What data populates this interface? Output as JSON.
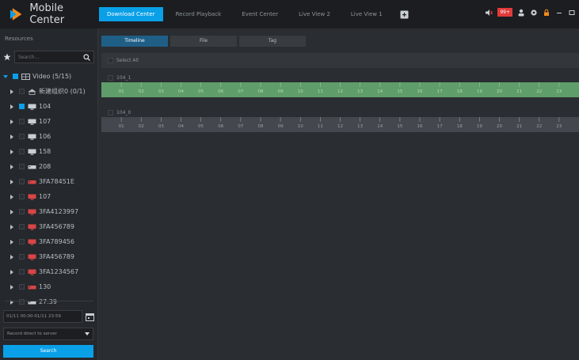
{
  "app": {
    "title": "Mobile Center",
    "nav_tabs": [
      {
        "label": "Download Center",
        "active": true
      },
      {
        "label": "Record Playback",
        "active": false
      },
      {
        "label": "Event Center",
        "active": false
      },
      {
        "label": "Live View 2",
        "active": false
      },
      {
        "label": "Live View 1",
        "active": false
      }
    ],
    "tray": {
      "alarm_count": "99+",
      "icons": [
        "speaker-icon",
        "alarm-badge",
        "user-icon",
        "gear-icon",
        "lock-icon",
        "minimize-icon",
        "maximize-icon"
      ]
    },
    "accent_color": "#0aa0e8"
  },
  "sidebar": {
    "title": "Resources",
    "search_placeholder": "Search...",
    "tree": [
      {
        "label": "Video (5/15)",
        "level": 0,
        "expanded": true,
        "check": "partial",
        "icon": "video-group-icon"
      },
      {
        "label": "新建组织0 (0/1)",
        "level": 1,
        "check": "none",
        "icon": "org-icon"
      },
      {
        "label": "104",
        "level": 1,
        "check": "checked",
        "icon": "monitor-icon"
      },
      {
        "label": "107",
        "level": 1,
        "check": "none",
        "icon": "monitor-icon"
      },
      {
        "label": "106",
        "level": 1,
        "check": "none",
        "icon": "monitor-icon"
      },
      {
        "label": "158",
        "level": 1,
        "check": "none",
        "icon": "monitor-icon"
      },
      {
        "label": "208",
        "level": 1,
        "check": "none",
        "icon": "recorder-icon"
      },
      {
        "label": "3FA78451E",
        "level": 1,
        "check": "none",
        "icon": "recorder-red-icon"
      },
      {
        "label": "107",
        "level": 1,
        "check": "none",
        "icon": "monitor-red-icon"
      },
      {
        "label": "3FA4123997",
        "level": 1,
        "check": "none",
        "icon": "monitor-red-icon"
      },
      {
        "label": "3FA456789",
        "level": 1,
        "check": "none",
        "icon": "monitor-red-icon"
      },
      {
        "label": "3FA789456",
        "level": 1,
        "check": "none",
        "icon": "monitor-red-icon"
      },
      {
        "label": "3FA456789",
        "level": 1,
        "check": "none",
        "icon": "monitor-red-icon"
      },
      {
        "label": "3FA1234567",
        "level": 1,
        "check": "none",
        "icon": "monitor-red-icon"
      },
      {
        "label": "130",
        "level": 1,
        "check": "none",
        "icon": "recorder-red-icon"
      },
      {
        "label": "27.39",
        "level": 1,
        "check": "none",
        "icon": "recorder-icon"
      }
    ],
    "date_range": "01/11 00:00-01/11 23:59",
    "record_source": "Record direct to server",
    "search_button": "Search"
  },
  "main": {
    "subtabs": [
      {
        "label": "Timeline",
        "active": true
      },
      {
        "label": "File",
        "active": false
      },
      {
        "label": "Tag",
        "active": false
      }
    ],
    "select_all": "Select All",
    "timelines": [
      {
        "channel": "104_1",
        "hours": [
          "01",
          "02",
          "03",
          "04",
          "05",
          "06",
          "07",
          "08",
          "09",
          "10",
          "11",
          "12",
          "13",
          "14",
          "15",
          "16",
          "17",
          "18",
          "19",
          "20",
          "21",
          "22",
          "23"
        ],
        "recording_color": "#5f9d6a"
      },
      {
        "channel": "104_0",
        "hours": [
          "01",
          "02",
          "03",
          "04",
          "05",
          "06",
          "07",
          "08",
          "09",
          "10",
          "11",
          "12",
          "13",
          "14",
          "15",
          "16",
          "17",
          "18",
          "19",
          "20",
          "21",
          "22",
          "23"
        ],
        "recording_color": "#44484e"
      }
    ]
  }
}
